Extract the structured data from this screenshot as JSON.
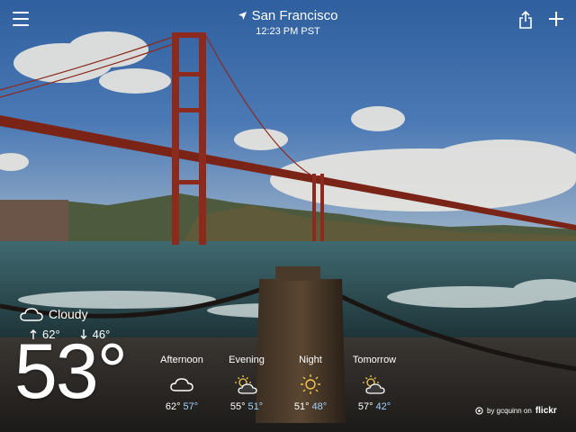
{
  "header": {
    "city": "San Francisco",
    "time": "12:23 PM PST"
  },
  "current": {
    "condition": "Cloudy",
    "high": "62°",
    "low": "46°",
    "temp": "53°"
  },
  "forecast": [
    {
      "label": "Afternoon",
      "icon": "cloud-icon",
      "high": "62°",
      "low": "57°"
    },
    {
      "label": "Evening",
      "icon": "partly-sunny-icon",
      "high": "55°",
      "low": "51°"
    },
    {
      "label": "Night",
      "icon": "sun-icon",
      "high": "51°",
      "low": "48°"
    },
    {
      "label": "Tomorrow",
      "icon": "partly-sunny-icon",
      "high": "57°",
      "low": "42°"
    }
  ],
  "credit": {
    "by": "by gcquinn on",
    "source": "flickr"
  },
  "colors": {
    "low_temp": "#9fd3ff",
    "sky": "#3b6fae"
  }
}
